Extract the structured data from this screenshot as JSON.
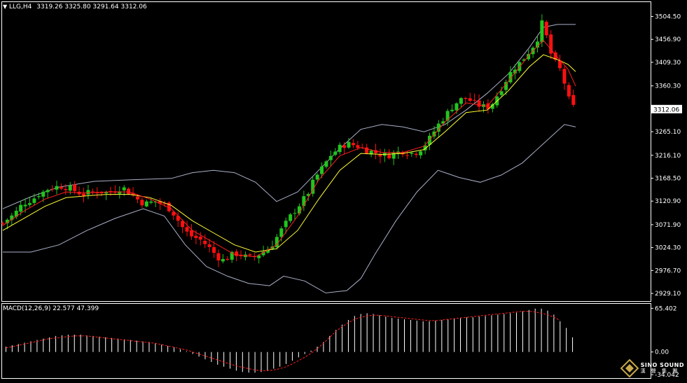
{
  "header": {
    "symbol": "LLG,H4",
    "ohlc": "3319.26 3325.80 3291.64 3312.06"
  },
  "macd_header": {
    "label": "MACD(12,26,9) 22.577 47.399"
  },
  "logo": {
    "brand_en": "SINO SOUND",
    "brand_cn": "漢 聲 集 團"
  },
  "colors": {
    "background": "#000000",
    "bull_candle": "#22c41e",
    "bear_candle": "#ff1010",
    "ma_fast": "#ff2020",
    "ma_slow": "#ffff33",
    "bollinger": "#aab0c8",
    "macd_hist": "#ffffff",
    "macd_signal": "#ff2020",
    "frame": "#ffffff"
  },
  "chart_data": [
    {
      "type": "candlestick",
      "name": "LLG,H4",
      "price_axis_ticks": [
        "3504.50",
        "3456.90",
        "3409.30",
        "3360.30",
        "3265.10",
        "3216.10",
        "3168.50",
        "3120.90",
        "3071.90",
        "3024.30",
        "2976.70",
        "2929.10"
      ],
      "price_axis_values": [
        3504.5,
        3456.9,
        3409.3,
        3360.3,
        3265.1,
        3216.1,
        3168.5,
        3120.9,
        3071.9,
        3024.3,
        2976.7,
        2929.1
      ],
      "current_price_label": "3312.06",
      "current_price": 3312.06,
      "ylim": [
        2919,
        3530
      ],
      "close_path": [
        [
          0,
          3075
        ],
        [
          8,
          3085
        ],
        [
          15,
          3092
        ],
        [
          20,
          3100
        ],
        [
          28,
          3115
        ],
        [
          35,
          3120
        ],
        [
          43,
          3125
        ],
        [
          50,
          3135
        ],
        [
          58,
          3140
        ],
        [
          66,
          3148
        ],
        [
          74,
          3150
        ],
        [
          82,
          3152
        ],
        [
          90,
          3150
        ],
        [
          98,
          3146
        ],
        [
          106,
          3140
        ],
        [
          114,
          3135
        ],
        [
          122,
          3138
        ],
        [
          130,
          3140
        ],
        [
          138,
          3142
        ],
        [
          146,
          3138
        ],
        [
          154,
          3140
        ],
        [
          162,
          3145
        ],
        [
          170,
          3150
        ],
        [
          178,
          3142
        ],
        [
          186,
          3132
        ],
        [
          194,
          3122
        ],
        [
          202,
          3115
        ],
        [
          210,
          3118
        ],
        [
          218,
          3120
        ],
        [
          226,
          3115
        ],
        [
          234,
          3110
        ],
        [
          242,
          3098
        ],
        [
          250,
          3080
        ],
        [
          258,
          3062
        ],
        [
          266,
          3050
        ],
        [
          274,
          3045
        ],
        [
          282,
          3040
        ],
        [
          290,
          3030
        ],
        [
          298,
          3018
        ],
        [
          306,
          3005
        ],
        [
          314,
          2998
        ],
        [
          322,
          3005
        ],
        [
          330,
          3012
        ],
        [
          338,
          3010
        ],
        [
          346,
          3005
        ],
        [
          354,
          3002
        ],
        [
          362,
          3008
        ],
        [
          370,
          3015
        ],
        [
          378,
          3022
        ],
        [
          386,
          3035
        ],
        [
          394,
          3055
        ],
        [
          402,
          3072
        ],
        [
          410,
          3090
        ],
        [
          418,
          3105
        ],
        [
          426,
          3120
        ],
        [
          434,
          3135
        ],
        [
          442,
          3160
        ],
        [
          450,
          3180
        ],
        [
          458,
          3195
        ],
        [
          466,
          3215
        ],
        [
          474,
          3225
        ],
        [
          482,
          3235
        ],
        [
          490,
          3240
        ],
        [
          498,
          3238
        ],
        [
          506,
          3235
        ],
        [
          514,
          3230
        ],
        [
          522,
          3225
        ],
        [
          530,
          3222
        ],
        [
          538,
          3218
        ],
        [
          546,
          3215
        ],
        [
          554,
          3218
        ],
        [
          562,
          3222
        ],
        [
          570,
          3225
        ],
        [
          578,
          3222
        ],
        [
          586,
          3220
        ],
        [
          594,
          3228
        ],
        [
          602,
          3240
        ],
        [
          610,
          3255
        ],
        [
          618,
          3275
        ],
        [
          626,
          3290
        ],
        [
          634,
          3305
        ],
        [
          642,
          3320
        ],
        [
          650,
          3330
        ],
        [
          658,
          3335
        ],
        [
          666,
          3330
        ],
        [
          674,
          3322
        ],
        [
          682,
          3318
        ],
        [
          690,
          3315
        ],
        [
          698,
          3325
        ],
        [
          706,
          3345
        ],
        [
          714,
          3365
        ],
        [
          722,
          3385
        ],
        [
          730,
          3400
        ],
        [
          738,
          3410
        ],
        [
          746,
          3425
        ],
        [
          754,
          3440
        ],
        [
          762,
          3460
        ],
        [
          768,
          3490
        ],
        [
          774,
          3465
        ],
        [
          780,
          3430
        ],
        [
          786,
          3410
        ],
        [
          792,
          3400
        ],
        [
          798,
          3380
        ],
        [
          804,
          3340
        ],
        [
          810,
          3320
        ],
        [
          816,
          3312
        ]
      ],
      "ma_fast_path": [
        [
          0,
          3070
        ],
        [
          30,
          3100
        ],
        [
          60,
          3125
        ],
        [
          90,
          3140
        ],
        [
          120,
          3138
        ],
        [
          150,
          3140
        ],
        [
          180,
          3140
        ],
        [
          210,
          3125
        ],
        [
          240,
          3105
        ],
        [
          270,
          3060
        ],
        [
          300,
          3035
        ],
        [
          330,
          3010
        ],
        [
          360,
          3005
        ],
        [
          390,
          3030
        ],
        [
          420,
          3090
        ],
        [
          450,
          3165
        ],
        [
          480,
          3215
        ],
        [
          510,
          3232
        ],
        [
          540,
          3222
        ],
        [
          570,
          3222
        ],
        [
          600,
          3235
        ],
        [
          630,
          3285
        ],
        [
          660,
          3325
        ],
        [
          690,
          3318
        ],
        [
          720,
          3370
        ],
        [
          750,
          3425
        ],
        [
          770,
          3455
        ],
        [
          790,
          3420
        ],
        [
          805,
          3395
        ],
        [
          816,
          3360
        ]
      ],
      "ma_slow_path": [
        [
          0,
          3060
        ],
        [
          30,
          3085
        ],
        [
          60,
          3110
        ],
        [
          90,
          3128
        ],
        [
          120,
          3132
        ],
        [
          150,
          3135
        ],
        [
          180,
          3135
        ],
        [
          210,
          3128
        ],
        [
          240,
          3112
        ],
        [
          270,
          3080
        ],
        [
          300,
          3055
        ],
        [
          330,
          3030
        ],
        [
          360,
          3015
        ],
        [
          390,
          3022
        ],
        [
          420,
          3060
        ],
        [
          450,
          3125
        ],
        [
          480,
          3185
        ],
        [
          510,
          3220
        ],
        [
          540,
          3218
        ],
        [
          570,
          3220
        ],
        [
          600,
          3228
        ],
        [
          630,
          3265
        ],
        [
          660,
          3305
        ],
        [
          690,
          3310
        ],
        [
          720,
          3350
        ],
        [
          750,
          3400
        ],
        [
          770,
          3425
        ],
        [
          790,
          3415
        ],
        [
          805,
          3405
        ],
        [
          816,
          3390
        ]
      ],
      "bb_upper_path": [
        [
          0,
          3105
        ],
        [
          40,
          3130
        ],
        [
          80,
          3150
        ],
        [
          130,
          3162
        ],
        [
          180,
          3165
        ],
        [
          240,
          3168
        ],
        [
          270,
          3180
        ],
        [
          300,
          3185
        ],
        [
          330,
          3180
        ],
        [
          360,
          3160
        ],
        [
          390,
          3120
        ],
        [
          420,
          3140
        ],
        [
          450,
          3185
        ],
        [
          480,
          3230
        ],
        [
          510,
          3270
        ],
        [
          540,
          3280
        ],
        [
          570,
          3275
        ],
        [
          600,
          3265
        ],
        [
          630,
          3280
        ],
        [
          660,
          3310
        ],
        [
          690,
          3345
        ],
        [
          720,
          3385
        ],
        [
          750,
          3440
        ],
        [
          770,
          3482
        ],
        [
          790,
          3488
        ],
        [
          816,
          3488
        ]
      ],
      "bb_lower_path": [
        [
          0,
          3015
        ],
        [
          40,
          3015
        ],
        [
          80,
          3030
        ],
        [
          120,
          3060
        ],
        [
          160,
          3085
        ],
        [
          200,
          3105
        ],
        [
          230,
          3090
        ],
        [
          260,
          3030
        ],
        [
          290,
          2985
        ],
        [
          320,
          2965
        ],
        [
          350,
          2950
        ],
        [
          380,
          2945
        ],
        [
          400,
          2965
        ],
        [
          430,
          2955
        ],
        [
          460,
          2930
        ],
        [
          490,
          2935
        ],
        [
          510,
          2960
        ],
        [
          530,
          3010
        ],
        [
          560,
          3080
        ],
        [
          590,
          3140
        ],
        [
          620,
          3185
        ],
        [
          650,
          3170
        ],
        [
          680,
          3160
        ],
        [
          710,
          3175
        ],
        [
          740,
          3200
        ],
        [
          770,
          3240
        ],
        [
          800,
          3280
        ],
        [
          816,
          3275
        ]
      ]
    },
    {
      "type": "bar",
      "name": "MACD(12,26,9)",
      "macd_value": 22.577,
      "signal_value": 47.399,
      "axis_ticks": [
        "65.402",
        "0.00",
        "-34.042"
      ],
      "axis_values": [
        65.402,
        0,
        -34.042
      ],
      "ylim": [
        -36,
        70
      ],
      "histogram": [
        8,
        10,
        12,
        14,
        16,
        18,
        20,
        22,
        24,
        25,
        26,
        26,
        26,
        25,
        24,
        23,
        22,
        21,
        20,
        19,
        18,
        17,
        16,
        15,
        13,
        11,
        9,
        7,
        4,
        1,
        -3,
        -7,
        -11,
        -15,
        -19,
        -22,
        -25,
        -28,
        -30,
        -31,
        -31,
        -30,
        -28,
        -25,
        -22,
        -18,
        -13,
        -8,
        -3,
        2,
        8,
        15,
        24,
        33,
        41,
        48,
        54,
        57,
        58,
        57,
        55,
        53,
        51,
        50,
        49,
        48,
        47,
        46,
        46,
        47,
        48,
        49,
        50,
        51,
        52,
        52,
        53,
        54,
        55,
        56,
        57,
        58,
        59,
        61,
        63,
        65,
        65,
        62,
        56,
        46,
        36,
        22
      ],
      "signal": [
        6,
        8,
        10,
        12,
        14,
        16,
        18,
        20,
        21,
        22,
        23,
        24,
        24,
        24,
        23,
        22,
        21,
        20,
        19,
        18,
        17,
        16,
        15,
        14,
        13,
        11,
        9,
        7,
        5,
        3,
        0,
        -3,
        -6,
        -9,
        -12,
        -15,
        -18,
        -21,
        -23,
        -25,
        -27,
        -28,
        -28,
        -27,
        -25,
        -22,
        -18,
        -13,
        -8,
        -2,
        5,
        13,
        22,
        31,
        38,
        44,
        49,
        52,
        54,
        55,
        55,
        54,
        53,
        52,
        51,
        50,
        49,
        48,
        47,
        47,
        48,
        49,
        50,
        51,
        52,
        53,
        54,
        55,
        56,
        57,
        58,
        59,
        60,
        61,
        61,
        60,
        58,
        56,
        52,
        47.399
      ]
    }
  ]
}
